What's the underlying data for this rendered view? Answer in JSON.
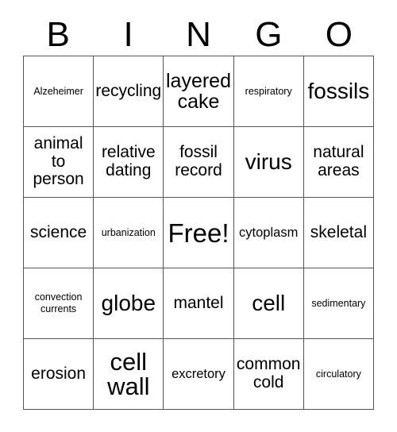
{
  "card": {
    "header_letters": [
      "B",
      "I",
      "N",
      "G",
      "O"
    ],
    "grid_size": 5,
    "colors": {
      "background": "#ffffff",
      "text": "#000000",
      "border": "#555555"
    },
    "rows": [
      [
        {
          "label": "Alzeheimer",
          "size": "xs"
        },
        {
          "label": "recycling",
          "size": "md"
        },
        {
          "label": "layered\ncake",
          "size": "lg"
        },
        {
          "label": "respiratory",
          "size": "xs"
        },
        {
          "label": "fossils",
          "size": "xl"
        }
      ],
      [
        {
          "label": "animal\nto\nperson",
          "size": "md"
        },
        {
          "label": "relative\ndating",
          "size": "md"
        },
        {
          "label": "fossil\nrecord",
          "size": "md"
        },
        {
          "label": "virus",
          "size": "xl"
        },
        {
          "label": "natural\nareas",
          "size": "md"
        }
      ],
      [
        {
          "label": "science",
          "size": "md"
        },
        {
          "label": "urbanization",
          "size": "xs"
        },
        {
          "label": "Free!",
          "size": "free"
        },
        {
          "label": "cytoplasm",
          "size": "sm"
        },
        {
          "label": "skeletal",
          "size": "md"
        }
      ],
      [
        {
          "label": "convection\ncurrents",
          "size": "xs"
        },
        {
          "label": "globe",
          "size": "xl"
        },
        {
          "label": "mantel",
          "size": "md"
        },
        {
          "label": "cell",
          "size": "xl"
        },
        {
          "label": "sedimentary",
          "size": "xs"
        }
      ],
      [
        {
          "label": "erosion",
          "size": "md"
        },
        {
          "label": "cell\nwall",
          "size": "xxl"
        },
        {
          "label": "excretory",
          "size": "sm"
        },
        {
          "label": "common\ncold",
          "size": "md"
        },
        {
          "label": "circulatory",
          "size": "xs"
        }
      ]
    ]
  }
}
